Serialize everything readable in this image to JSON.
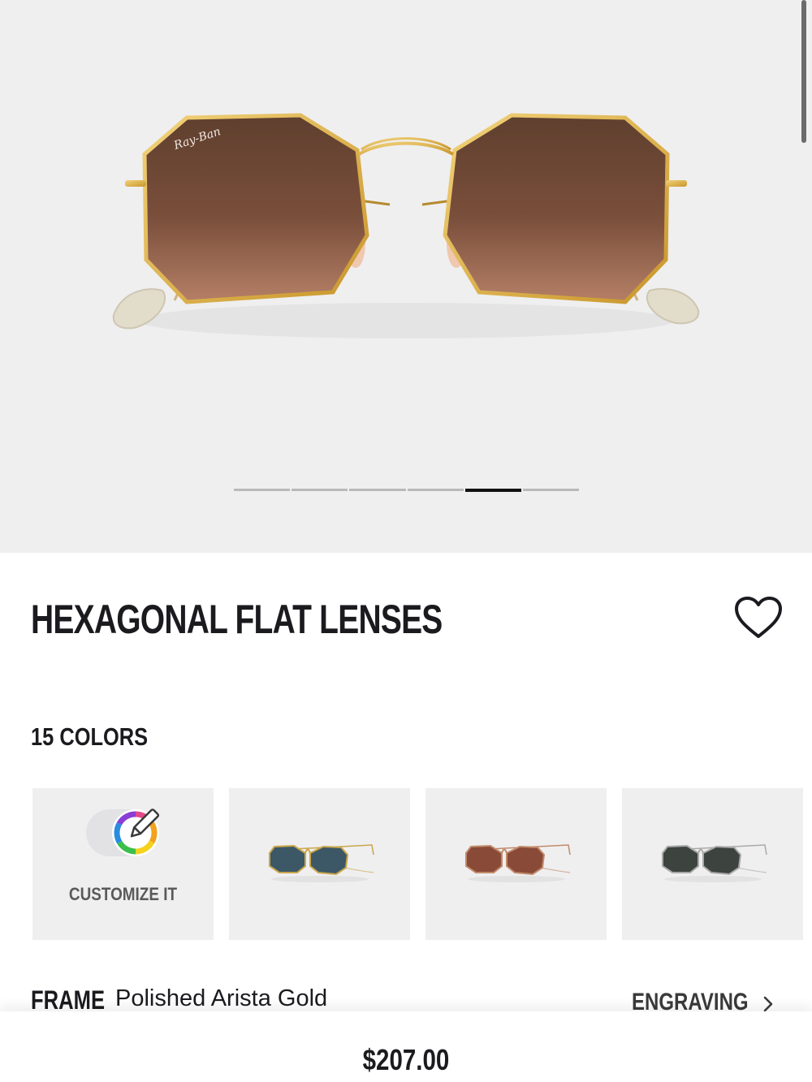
{
  "product": {
    "title": "HEXAGONAL FLAT LENSES",
    "brand_logo_text": "Ray-Ban",
    "price": "$207.00"
  },
  "gallery": {
    "slide_count": 6,
    "active_slide": 5
  },
  "colors": {
    "count_label": "15 COLORS",
    "customize_label": "CUSTOMIZE IT",
    "swatches": [
      {
        "name": "gold-frame-blue-lens",
        "frame_color": "#c9a64a",
        "lens_color": "#3c5866"
      },
      {
        "name": "copper-frame-brown-lens",
        "frame_color": "#c18a6a",
        "lens_color": "#8a4a38"
      },
      {
        "name": "silver-frame-grey-lens",
        "frame_color": "#a9a9a9",
        "lens_color": "#3d4440"
      }
    ]
  },
  "frame": {
    "label": "FRAME",
    "value": "Polished Arista Gold"
  },
  "engraving": {
    "label": "ENGRAVING"
  },
  "icons": {
    "favorite": "heart-icon",
    "customize": "color-wheel-pencil-icon",
    "engraving": "chevron-right-icon"
  },
  "theme": {
    "hero_background": "#efeff0",
    "frame_gold": "#d4ad3f",
    "lens_brown": "#6b4634",
    "text": "#1b1b1f"
  }
}
